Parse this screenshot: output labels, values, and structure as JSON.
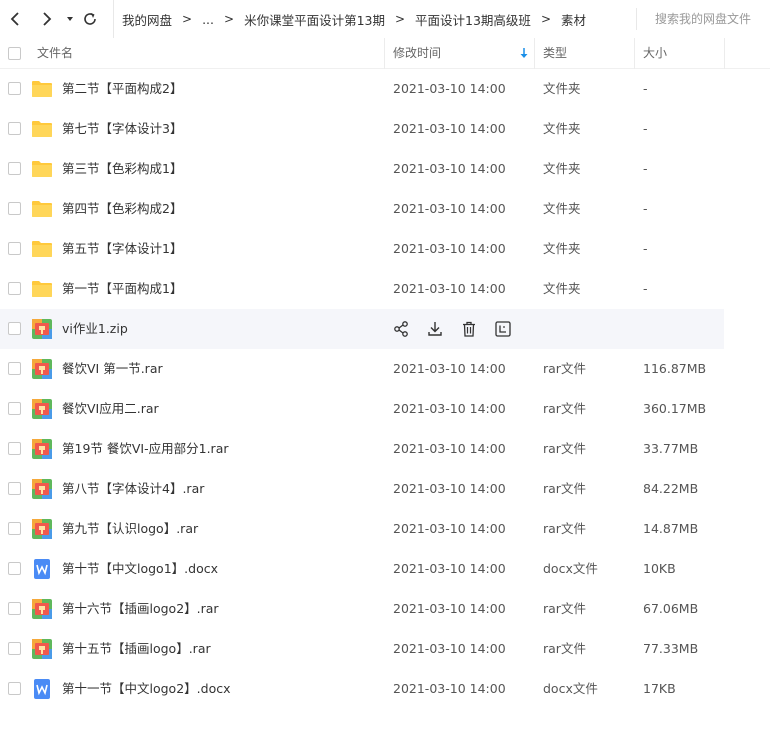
{
  "breadcrumb": {
    "items": [
      "我的网盘",
      "...",
      "米你课堂平面设计第13期",
      "平面设计13期高级班",
      "素材"
    ],
    "separator": ">"
  },
  "search": {
    "placeholder": "搜索我的网盘文件"
  },
  "columns": {
    "name": "文件名",
    "modified": "修改时间",
    "type": "类型",
    "size": "大小"
  },
  "colors": {
    "accent": "#1a8fe8",
    "folder": "#ffc93c",
    "rar_icon": "#f0594c",
    "docx_icon": "#4a8bf5"
  },
  "files": [
    {
      "name": "第二节【平面构成2】",
      "time": "2021-03-10 14:00",
      "type": "文件夹",
      "size": "-",
      "icon": "folder-icon"
    },
    {
      "name": "第七节【字体设计3】",
      "time": "2021-03-10 14:00",
      "type": "文件夹",
      "size": "-",
      "icon": "folder-icon"
    },
    {
      "name": "第三节【色彩构成1】",
      "time": "2021-03-10 14:00",
      "type": "文件夹",
      "size": "-",
      "icon": "folder-icon"
    },
    {
      "name": "第四节【色彩构成2】",
      "time": "2021-03-10 14:00",
      "type": "文件夹",
      "size": "-",
      "icon": "folder-icon"
    },
    {
      "name": "第五节【字体设计1】",
      "time": "2021-03-10 14:00",
      "type": "文件夹",
      "size": "-",
      "icon": "folder-icon"
    },
    {
      "name": "第一节【平面构成1】",
      "time": "2021-03-10 14:00",
      "type": "文件夹",
      "size": "-",
      "icon": "folder-icon"
    },
    {
      "name": "vi作业1.zip",
      "time": "",
      "type": "",
      "size": "",
      "icon": "archive-icon",
      "hover": true
    },
    {
      "name": "餐饮VI   第一节.rar",
      "time": "2021-03-10 14:00",
      "type": "rar文件",
      "size": "116.87MB",
      "icon": "archive-icon"
    },
    {
      "name": "餐饮VI应用二.rar",
      "time": "2021-03-10 14:00",
      "type": "rar文件",
      "size": "360.17MB",
      "icon": "archive-icon"
    },
    {
      "name": "第19节 餐饮VI-应用部分1.rar",
      "time": "2021-03-10 14:00",
      "type": "rar文件",
      "size": "33.77MB",
      "icon": "archive-icon"
    },
    {
      "name": "第八节【字体设计4】.rar",
      "time": "2021-03-10 14:00",
      "type": "rar文件",
      "size": "84.22MB",
      "icon": "archive-icon"
    },
    {
      "name": "第九节【认识logo】.rar",
      "time": "2021-03-10 14:00",
      "type": "rar文件",
      "size": "14.87MB",
      "icon": "archive-icon"
    },
    {
      "name": "第十节【中文logo1】.docx",
      "time": "2021-03-10 14:00",
      "type": "docx文件",
      "size": "10KB",
      "icon": "word-icon"
    },
    {
      "name": "第十六节【插画logo2】.rar",
      "time": "2021-03-10 14:00",
      "type": "rar文件",
      "size": "67.06MB",
      "icon": "archive-icon"
    },
    {
      "name": "第十五节【插画logo】.rar",
      "time": "2021-03-10 14:00",
      "type": "rar文件",
      "size": "77.33MB",
      "icon": "archive-icon"
    },
    {
      "name": "第十一节【中文logo2】.docx",
      "time": "2021-03-10 14:00",
      "type": "docx文件",
      "size": "17KB",
      "icon": "word-icon"
    }
  ],
  "row_actions": [
    "share-icon",
    "download-icon",
    "delete-icon",
    "more-icon"
  ]
}
